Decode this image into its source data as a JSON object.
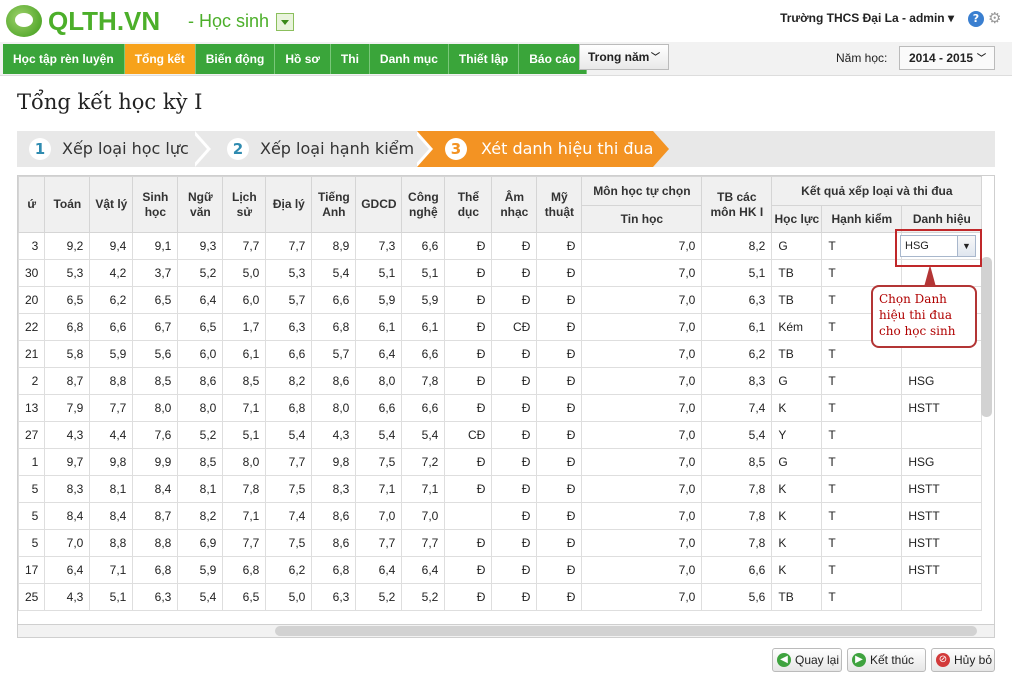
{
  "app": {
    "brand": "QLTH.VN",
    "module": "- Học sinh",
    "school": "Trường THCS Đại La - admin ▾"
  },
  "nav": {
    "items": [
      "Học tập rèn luyện",
      "Tổng kết",
      "Biến động",
      "Hồ sơ",
      "Thi",
      "Danh mục",
      "Thiết lập",
      "Báo cáo"
    ],
    "active_index": 1,
    "period": "Trong năm",
    "year_label": "Năm học:",
    "year_value": "2014 - 2015"
  },
  "page_title": "Tổng kết học kỳ I",
  "steps": [
    {
      "num": "1",
      "label": "Xếp loại học lực"
    },
    {
      "num": "2",
      "label": "Xếp loại hạnh kiểm"
    },
    {
      "num": "3",
      "label": "Xét danh hiệu thi đua"
    }
  ],
  "table": {
    "headers": {
      "stt": "ứ",
      "toan": "Toán",
      "vatly": "Vật lý",
      "sinhhoc": "Sinh học",
      "nguvan": "Ngữ văn",
      "lichsu": "Lịch sử",
      "dialy": "Địa lý",
      "tienganh": "Tiếng Anh",
      "gdcd": "GDCD",
      "congnghe": "Công nghệ",
      "theduc": "Thể dục",
      "amnhac": "Âm nhạc",
      "mythuat": "Mỹ thuật",
      "tuchon": "Môn học tự chọn",
      "tinhoc": "Tin học",
      "tb": "TB các môn HK I",
      "ketqua": "Kết quả xếp loại và thi đua",
      "hocluc": "Học lực",
      "hanhkiem": "Hạnh kiểm",
      "danhhieu": "Danh hiệu"
    },
    "rows": [
      [
        "3",
        "9,2",
        "9,4",
        "9,1",
        "9,3",
        "7,7",
        "7,7",
        "8,9",
        "7,3",
        "6,6",
        "Đ",
        "Đ",
        "Đ",
        "7,0",
        "8,2",
        "G",
        "T",
        ""
      ],
      [
        "30",
        "5,3",
        "4,2",
        "3,7",
        "5,2",
        "5,0",
        "5,3",
        "5,4",
        "5,1",
        "5,1",
        "Đ",
        "Đ",
        "Đ",
        "7,0",
        "5,1",
        "TB",
        "T",
        ""
      ],
      [
        "20",
        "6,5",
        "6,2",
        "6,5",
        "6,4",
        "6,0",
        "5,7",
        "6,6",
        "5,9",
        "5,9",
        "Đ",
        "Đ",
        "Đ",
        "7,0",
        "6,3",
        "TB",
        "T",
        ""
      ],
      [
        "22",
        "6,8",
        "6,6",
        "6,7",
        "6,5",
        "1,7",
        "6,3",
        "6,8",
        "6,1",
        "6,1",
        "Đ",
        "CĐ",
        "Đ",
        "7,0",
        "6,1",
        "Kém",
        "T",
        ""
      ],
      [
        "21",
        "5,8",
        "5,9",
        "5,6",
        "6,0",
        "6,1",
        "6,6",
        "5,7",
        "6,4",
        "6,6",
        "Đ",
        "Đ",
        "Đ",
        "7,0",
        "6,2",
        "TB",
        "T",
        ""
      ],
      [
        "2",
        "8,7",
        "8,8",
        "8,5",
        "8,6",
        "8,5",
        "8,2",
        "8,6",
        "8,0",
        "7,8",
        "Đ",
        "Đ",
        "Đ",
        "7,0",
        "8,3",
        "G",
        "T",
        "HSG"
      ],
      [
        "13",
        "7,9",
        "7,7",
        "8,0",
        "8,0",
        "7,1",
        "6,8",
        "8,0",
        "6,6",
        "6,6",
        "Đ",
        "Đ",
        "Đ",
        "7,0",
        "7,4",
        "K",
        "T",
        "HSTT"
      ],
      [
        "27",
        "4,3",
        "4,4",
        "7,6",
        "5,2",
        "5,1",
        "5,4",
        "4,3",
        "5,4",
        "5,4",
        "CĐ",
        "Đ",
        "Đ",
        "7,0",
        "5,4",
        "Y",
        "T",
        ""
      ],
      [
        "1",
        "9,7",
        "9,8",
        "9,9",
        "8,5",
        "8,0",
        "7,7",
        "9,8",
        "7,5",
        "7,2",
        "Đ",
        "Đ",
        "Đ",
        "7,0",
        "8,5",
        "G",
        "T",
        "HSG"
      ],
      [
        "5",
        "8,3",
        "8,1",
        "8,4",
        "8,1",
        "7,8",
        "7,5",
        "8,3",
        "7,1",
        "7,1",
        "Đ",
        "Đ",
        "Đ",
        "7,0",
        "7,8",
        "K",
        "T",
        "HSTT"
      ],
      [
        "5",
        "8,4",
        "8,4",
        "8,7",
        "8,2",
        "7,1",
        "7,4",
        "8,6",
        "7,0",
        "7,0",
        "",
        "Đ",
        "Đ",
        "7,0",
        "7,8",
        "K",
        "T",
        "HSTT"
      ],
      [
        "5",
        "7,0",
        "8,8",
        "8,8",
        "6,9",
        "7,7",
        "7,5",
        "8,6",
        "7,7",
        "7,7",
        "Đ",
        "Đ",
        "Đ",
        "7,0",
        "7,8",
        "K",
        "T",
        "HSTT"
      ],
      [
        "17",
        "6,4",
        "7,1",
        "6,8",
        "5,9",
        "6,8",
        "6,2",
        "6,8",
        "6,4",
        "6,4",
        "Đ",
        "Đ",
        "Đ",
        "7,0",
        "6,6",
        "K",
        "T",
        "HSTT"
      ],
      [
        "25",
        "4,3",
        "5,1",
        "6,3",
        "5,4",
        "6,5",
        "5,0",
        "6,3",
        "5,2",
        "5,2",
        "Đ",
        "Đ",
        "Đ",
        "7,0",
        "5,6",
        "TB",
        "T",
        ""
      ]
    ]
  },
  "combo_value": "HSG",
  "callout": "Chọn Danh hiệu thi đua cho học sinh",
  "buttons": {
    "back": "Quay lại",
    "finish": "Kết thúc",
    "cancel": "Hủy bỏ"
  },
  "colors": {
    "nav_green": "#3aa53a",
    "nav_active": "#f7a21b",
    "step_active": "#f39323",
    "callout_red": "#b33535"
  }
}
